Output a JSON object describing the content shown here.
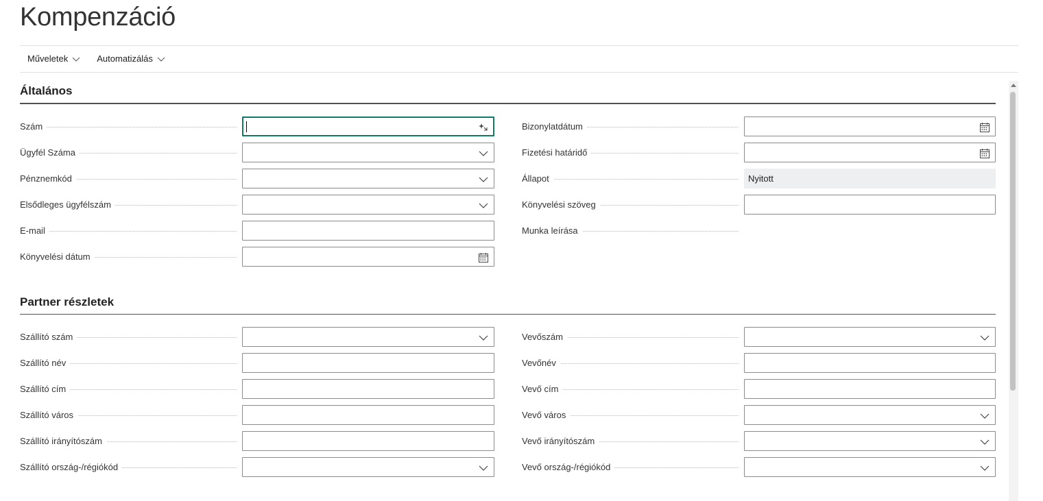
{
  "page": {
    "title": "Kompenzáció"
  },
  "actions": [
    {
      "label": "Műveletek",
      "icon": "chevron-down-icon"
    },
    {
      "label": "Automatizálás",
      "icon": "chevron-down-icon"
    }
  ],
  "sections": {
    "general": {
      "title": "Általános",
      "left": [
        {
          "label": "Szám",
          "value": "",
          "control": "assist"
        },
        {
          "label": "Ügyfél Száma",
          "value": "",
          "control": "dropdown"
        },
        {
          "label": "Pénznemkód",
          "value": "",
          "control": "dropdown"
        },
        {
          "label": "Elsődleges ügyfélszám",
          "value": "",
          "control": "dropdown"
        },
        {
          "label": "E-mail",
          "value": "",
          "control": "text"
        },
        {
          "label": "Könyvelési dátum",
          "value": "",
          "control": "date"
        }
      ],
      "right": [
        {
          "label": "Bizonylatdátum",
          "value": "",
          "control": "date"
        },
        {
          "label": "Fizetési határidő",
          "value": "",
          "control": "date"
        },
        {
          "label": "Állapot",
          "value": "Nyitott",
          "control": "readonly"
        },
        {
          "label": "Könyvelési szöveg",
          "value": "",
          "control": "text"
        },
        {
          "label": "Munka leírása",
          "value": "",
          "control": "none"
        }
      ]
    },
    "partner": {
      "title": "Partner részletek",
      "left": [
        {
          "label": "Szállító szám",
          "value": "",
          "control": "dropdown"
        },
        {
          "label": "Szállító név",
          "value": "",
          "control": "text"
        },
        {
          "label": "Szállító cím",
          "value": "",
          "control": "text"
        },
        {
          "label": "Szállító város",
          "value": "",
          "control": "text"
        },
        {
          "label": "Szállító irányítószám",
          "value": "",
          "control": "text"
        },
        {
          "label": "Szállító ország-/régiókód",
          "value": "",
          "control": "dropdown"
        }
      ],
      "right": [
        {
          "label": "Vevőszám",
          "value": "",
          "control": "dropdown"
        },
        {
          "label": "Vevőnév",
          "value": "",
          "control": "text"
        },
        {
          "label": "Vevő cím",
          "value": "",
          "control": "text"
        },
        {
          "label": "Vevő város",
          "value": "",
          "control": "dropdown"
        },
        {
          "label": "Vevő irányítószám",
          "value": "",
          "control": "dropdown"
        },
        {
          "label": "Vevő ország-/régiókód",
          "value": "",
          "control": "dropdown"
        }
      ]
    }
  },
  "colors": {
    "focus": "#117a65",
    "rule": "#505050",
    "readonly_bg": "#edeff0"
  }
}
